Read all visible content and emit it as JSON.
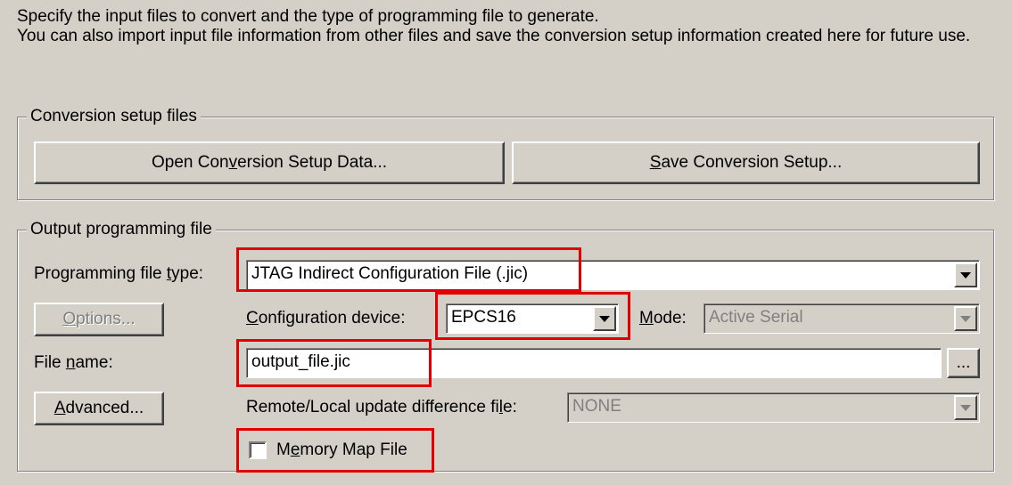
{
  "intro": {
    "line1": "Specify the input files to convert and the type of programming file to generate.",
    "line2": "You can also import input file information from other files and save the conversion setup information created here for future use."
  },
  "conversion_setup": {
    "title": "Conversion setup files",
    "open_button": {
      "pre": "Open Con",
      "key": "v",
      "post": "ersion Setup Data..."
    },
    "save_button": {
      "pre": "",
      "key": "S",
      "post": "ave Conversion Setup..."
    }
  },
  "output": {
    "title": "Output programming file",
    "type_label": {
      "pre": "Programming file ",
      "key": "t",
      "post": "ype:"
    },
    "type_value": "JTAG Indirect Configuration File (.jic)",
    "options_button": {
      "pre": "",
      "key": "O",
      "post": "ptions..."
    },
    "device_label": {
      "pre": "",
      "key": "C",
      "post": "onfiguration device:"
    },
    "device_value": "EPCS16",
    "mode_label": {
      "pre": "",
      "key": "M",
      "post": "ode:"
    },
    "mode_value": "Active Serial",
    "filename_label": {
      "pre": "File ",
      "key": "n",
      "post": "ame:"
    },
    "filename_value": "output_file.jic",
    "browse_button": "...",
    "advanced_button": {
      "pre": "",
      "key": "A",
      "post": "dvanced..."
    },
    "diff_label": {
      "pre": "Remote/Local update difference fi",
      "key": "l",
      "post": "e:"
    },
    "diff_value": "NONE",
    "memory_map": {
      "pre": "M",
      "key": "e",
      "post": "mory Map File",
      "checked": false
    }
  },
  "colors": {
    "highlight": "#e00000",
    "face": "#d4d0c8"
  }
}
